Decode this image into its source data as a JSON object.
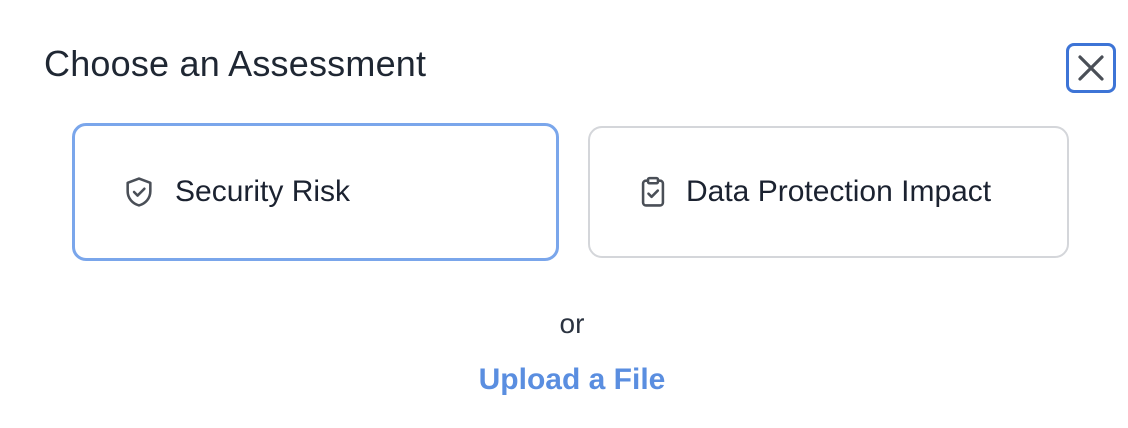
{
  "modal": {
    "title": "Choose an Assessment",
    "close_icon": "close-icon"
  },
  "options": [
    {
      "label": "Security Risk",
      "icon": "shield-check-icon",
      "selected": true
    },
    {
      "label": "Data Protection Impact",
      "icon": "clipboard-check-icon",
      "selected": false
    }
  ],
  "divider_text": "or",
  "upload_link": "Upload a File",
  "colors": {
    "accent": "#5a8ee0",
    "selected_border": "#7aa6eb",
    "card_border": "#d4d6da",
    "text": "#1b2230"
  }
}
